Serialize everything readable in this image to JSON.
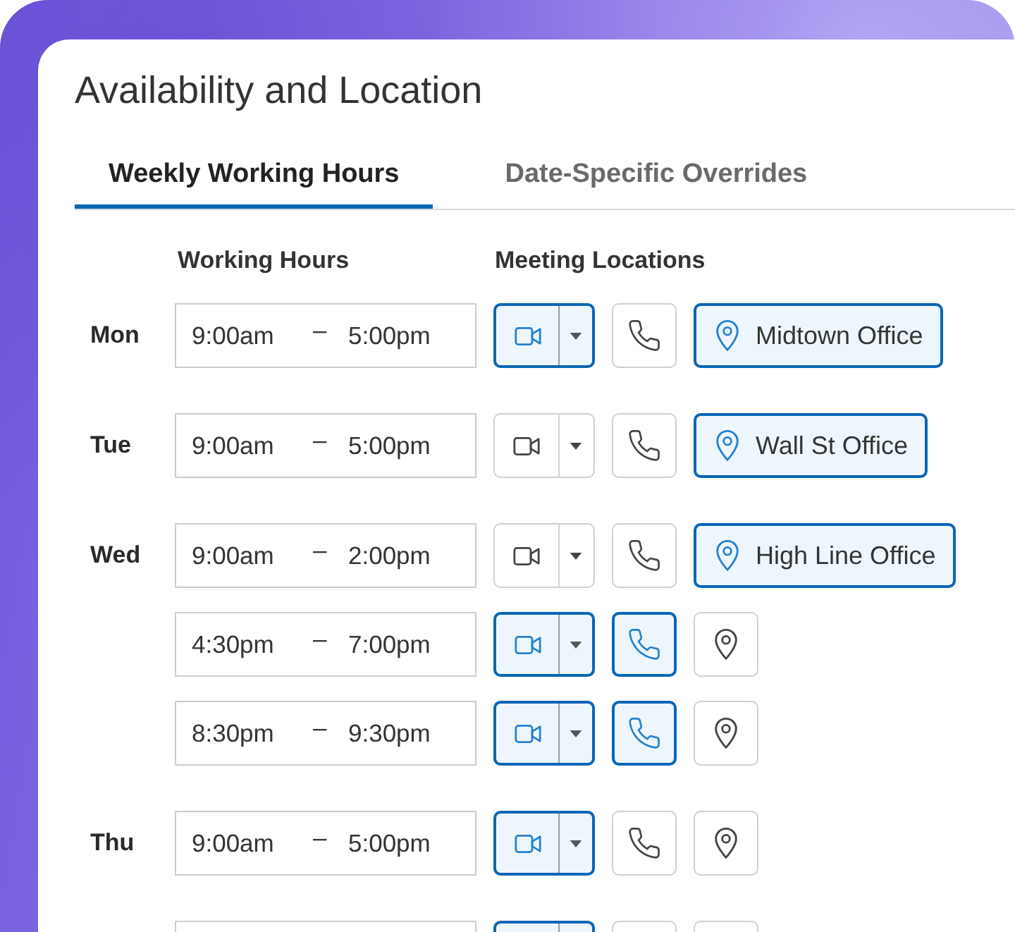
{
  "title": "Availability and Location",
  "tabs": [
    {
      "label": "Weekly Working Hours",
      "selected": true
    },
    {
      "label": "Date-Specific Overrides",
      "selected": false
    }
  ],
  "column_headers": [
    "Working Hours",
    "Meeting Locations"
  ],
  "days": [
    {
      "day": "Mon",
      "slots": [
        {
          "start": "9:00am",
          "separator": "–",
          "end": "5:00pm",
          "video": {
            "selected": true
          },
          "phone": {
            "selected": false
          },
          "location": {
            "selected": true,
            "label": "Midtown Office"
          }
        }
      ]
    },
    {
      "day": "Tue",
      "slots": [
        {
          "start": "9:00am",
          "separator": "–",
          "end": "5:00pm",
          "video": {
            "selected": false
          },
          "phone": {
            "selected": false
          },
          "location": {
            "selected": true,
            "label": "Wall St Office"
          }
        }
      ]
    },
    {
      "day": "Wed",
      "slots": [
        {
          "start": "9:00am",
          "separator": "–",
          "end": "2:00pm",
          "video": {
            "selected": false
          },
          "phone": {
            "selected": false
          },
          "location": {
            "selected": true,
            "label": "High Line Office"
          }
        },
        {
          "start": "4:30pm",
          "separator": "–",
          "end": "7:00pm",
          "video": {
            "selected": true
          },
          "phone": {
            "selected": true
          },
          "location": {
            "selected": false
          }
        },
        {
          "start": "8:30pm",
          "separator": "–",
          "end": "9:30pm",
          "video": {
            "selected": true
          },
          "phone": {
            "selected": true
          },
          "location": {
            "selected": false
          }
        }
      ]
    },
    {
      "day": "Thu",
      "slots": [
        {
          "start": "9:00am",
          "separator": "–",
          "end": "5:00pm",
          "video": {
            "selected": true
          },
          "phone": {
            "selected": false
          },
          "location": {
            "selected": false
          }
        }
      ]
    },
    {
      "slots": [
        {
          "video": {
            "selected": true
          },
          "phone": {
            "selected": false
          },
          "location": {
            "selected": false
          }
        }
      ]
    }
  ]
}
